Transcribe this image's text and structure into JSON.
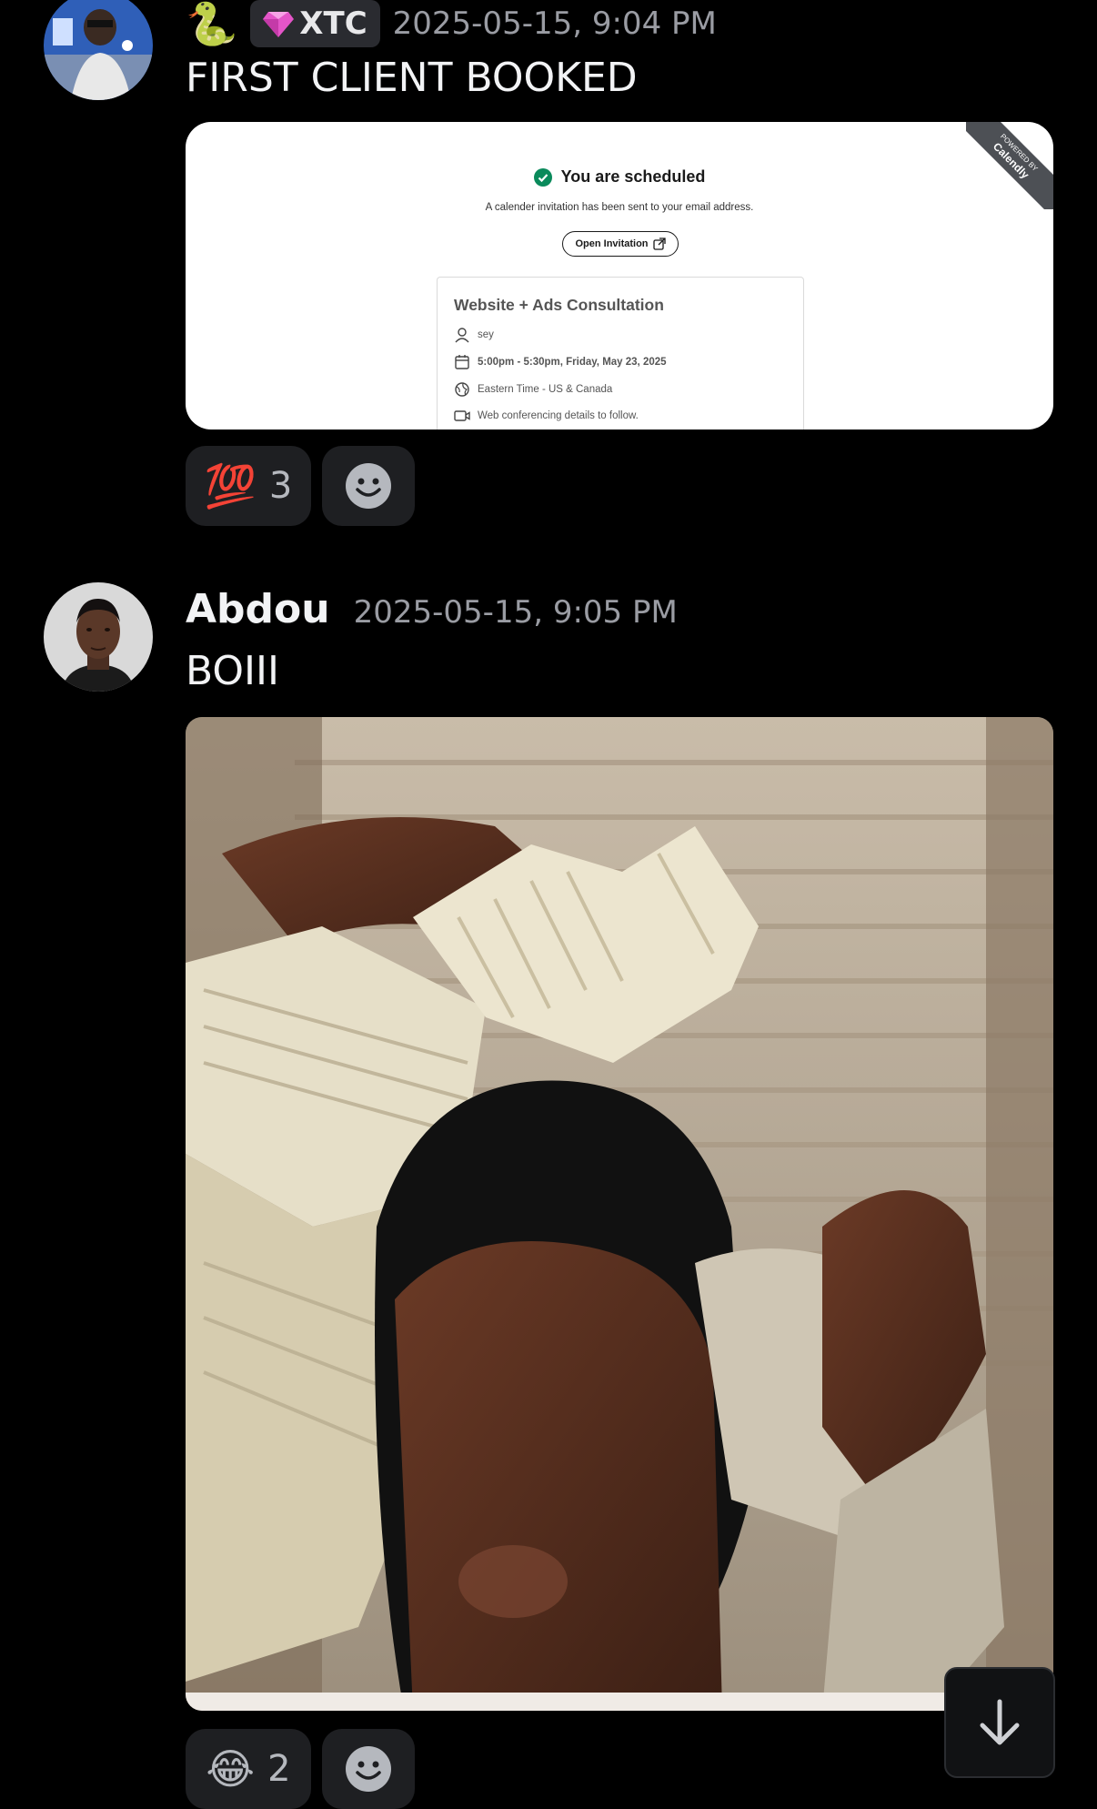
{
  "messages": [
    {
      "author_emoji": "🐍",
      "tag_label": "XTC",
      "timestamp": "2025-05-15, 9:04 PM",
      "text": "FIRST CLIENT BOOKED",
      "embed": {
        "corner_banner_top": "POWERED BY",
        "corner_banner_brand": "Calendly",
        "title": "You are scheduled",
        "subtitle": "A calender invitation has been sent to your email address.",
        "open_button": "Open Invitation",
        "event_title": "Website + Ads Consultation",
        "details": [
          {
            "icon": "person-icon",
            "text": "sey"
          },
          {
            "icon": "calendar-icon",
            "text": "5:00pm - 5:30pm, Friday, May 23, 2025"
          },
          {
            "icon": "globe-icon",
            "text": "Eastern Time - US & Canada"
          },
          {
            "icon": "video-icon",
            "text": "Web conferencing details to follow."
          }
        ]
      },
      "reactions": [
        {
          "emoji": "💯",
          "count": "3"
        }
      ]
    },
    {
      "author": "Abdou",
      "timestamp": "2025-05-15, 9:05 PM",
      "text": "BOIII",
      "reactions": [
        {
          "emoji": "😂",
          "count": "2"
        }
      ]
    }
  ],
  "colors": {
    "background": "#000000",
    "accent_green": "#0a8a5b",
    "reaction_bg": "#1e1f22"
  }
}
